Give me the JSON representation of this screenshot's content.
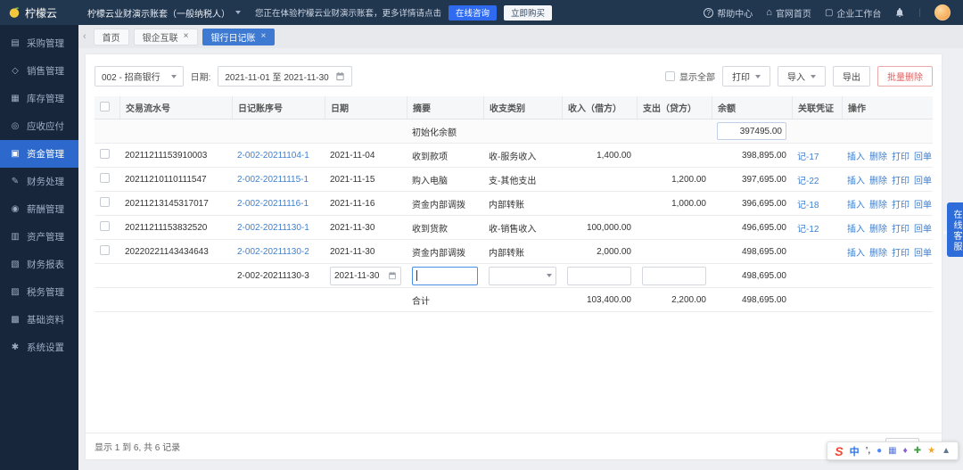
{
  "topbar": {
    "logo_text": "柠檬云",
    "account_name": "柠檬云业财演示账套（一般纳税人）",
    "notice_text": "您正在体验柠檬云业财演示账套，更多详情请点击",
    "consult_button": "在线咨询",
    "buy_button": "立即购买",
    "help_center": "帮助中心",
    "official_home": "官网首页",
    "workspace": "企业工作台"
  },
  "sidebar": {
    "items": [
      {
        "name": "purchase",
        "icon": "▤",
        "label": "采购管理",
        "active": false
      },
      {
        "name": "sales",
        "icon": "◇",
        "label": "销售管理",
        "active": false
      },
      {
        "name": "inventory",
        "icon": "▦",
        "label": "库存管理",
        "active": false
      },
      {
        "name": "receivable-payable",
        "icon": "◎",
        "label": "应收应付",
        "active": false
      },
      {
        "name": "funds",
        "icon": "▣",
        "label": "资金管理",
        "active": true
      },
      {
        "name": "finance-processing",
        "icon": "✎",
        "label": "财务处理",
        "active": false
      },
      {
        "name": "payroll",
        "icon": "◉",
        "label": "薪酬管理",
        "active": false
      },
      {
        "name": "assets",
        "icon": "▥",
        "label": "资产管理",
        "active": false
      },
      {
        "name": "reports",
        "icon": "▧",
        "label": "财务报表",
        "active": false
      },
      {
        "name": "tax",
        "icon": "▨",
        "label": "税务管理",
        "active": false
      },
      {
        "name": "base-data",
        "icon": "▩",
        "label": "基础资料",
        "active": false
      },
      {
        "name": "system-settings",
        "icon": "✱",
        "label": "系统设置",
        "active": false
      }
    ]
  },
  "tabs": [
    {
      "name": "home",
      "label": "首页",
      "closable": false,
      "active": false
    },
    {
      "name": "bank-enterprise-link",
      "label": "银企互联",
      "closable": true,
      "active": false
    },
    {
      "name": "bank-journal",
      "label": "银行日记账",
      "closable": true,
      "active": true
    }
  ],
  "toolbar": {
    "bank_select": "002 - 招商银行",
    "date_label": "日期:",
    "date_range": "2021-11-01 至 2021-11-30",
    "show_all_label": "显示全部",
    "print_button": "打印",
    "import_button": "导入",
    "export_button": "导出",
    "batch_delete_button": "批量删除"
  },
  "table": {
    "headers": [
      "交易流水号",
      "日记账序号",
      "日期",
      "摘要",
      "收支类别",
      "收入（借方）",
      "支出（贷方）",
      "余额",
      "关联凭证",
      "操作"
    ],
    "init_row": {
      "summary": "初始化余额",
      "balance": "397495.00"
    },
    "rows": [
      {
        "serial": "20211211153910003",
        "journal_no": "2-002-20211104-1",
        "date": "2021-11-04",
        "summary": "收到款项",
        "category": "收-服务收入",
        "income": "1,400.00",
        "expense": "",
        "balance": "398,895.00",
        "voucher": "记-17"
      },
      {
        "serial": "20211210110111547",
        "journal_no": "2-002-20211115-1",
        "date": "2021-11-15",
        "summary": "购入电脑",
        "category": "支-其他支出",
        "income": "",
        "expense": "1,200.00",
        "balance": "397,695.00",
        "voucher": "记-22"
      },
      {
        "serial": "20211213145317017",
        "journal_no": "2-002-20211116-1",
        "date": "2021-11-16",
        "summary": "资金内部调拨",
        "category": "内部转账",
        "income": "",
        "expense": "1,000.00",
        "balance": "396,695.00",
        "voucher": "记-18"
      },
      {
        "serial": "20211211153832520",
        "journal_no": "2-002-20211130-1",
        "date": "2021-11-30",
        "summary": "收到货款",
        "category": "收-销售收入",
        "income": "100,000.00",
        "expense": "",
        "balance": "496,695.00",
        "voucher": "记-12"
      },
      {
        "serial": "20220221143434643",
        "journal_no": "2-002-20211130-2",
        "date": "2021-11-30",
        "summary": "资金内部调拨",
        "category": "内部转账",
        "income": "2,000.00",
        "expense": "",
        "balance": "498,695.00",
        "voucher": ""
      }
    ],
    "actions": [
      "插入",
      "删除",
      "打印",
      "回单"
    ],
    "edit_row": {
      "journal_no": "2-002-20211130-3",
      "date": "2021-11-30",
      "balance": "498,695.00"
    },
    "total_row": {
      "label": "合计",
      "income": "103,400.00",
      "expense": "2,200.00",
      "balance": "498,695.00"
    }
  },
  "footer": {
    "records_info": "显示 1 到 6, 共 6 记录",
    "page_size": "20"
  },
  "ime": {
    "logo": "S",
    "mode": "中",
    "punct": "’,"
  },
  "cs_widget": {
    "label": "在线客服",
    "collapse": "«"
  }
}
